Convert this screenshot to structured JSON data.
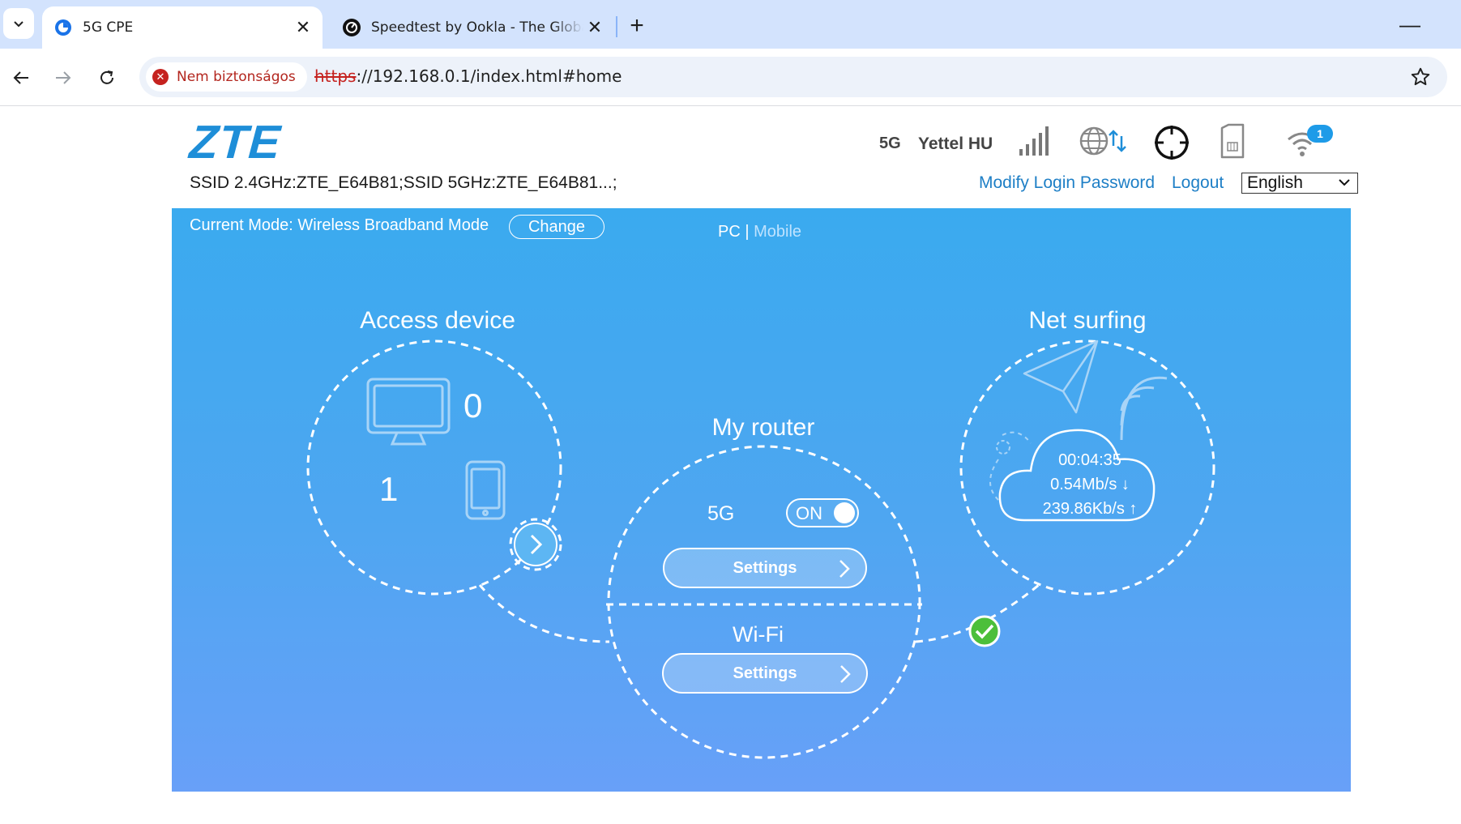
{
  "browser": {
    "tabs": [
      {
        "title": "5G CPE",
        "active": true
      },
      {
        "title": "Speedtest by Ookla - The Global Broadband Speed Test",
        "active": false
      }
    ],
    "security_label": "Nem biztonságos",
    "url_scheme": "https",
    "url_rest": "://192.168.0.1/index.html#home"
  },
  "header": {
    "logo": "ZTE",
    "ssid": "SSID 2.4GHz:ZTE_E64B81;SSID 5GHz:ZTE_E64B81...;",
    "network_type": "5G",
    "operator": "Yettel HU",
    "wifi_clients_badge": "1",
    "modify_password": "Modify Login Password",
    "logout": "Logout",
    "language": "English",
    "icons": [
      "signal-icon",
      "internet-status-icon",
      "target-icon",
      "sim-card-icon",
      "wifi-icon"
    ]
  },
  "panel": {
    "mode": "Current Mode: Wireless Broadband Mode",
    "change": "Change",
    "view_pc": "PC",
    "view_sep": "|",
    "view_mobile": "Mobile",
    "access_device": {
      "title": "Access device",
      "pc_count": "0",
      "mobile_count": "1"
    },
    "my_router": {
      "title": "My router",
      "band_label": "5G",
      "toggle_state": "ON",
      "settings_5g": "Settings",
      "wifi_label": "Wi-Fi",
      "settings_wifi": "Settings"
    },
    "net_surfing": {
      "title": "Net surfing",
      "duration": "00:04:35",
      "download": "0.54Mb/s ↓",
      "upload": "239.86Kb/s ↑"
    },
    "colors": {
      "panel_top": "#3aaaef",
      "panel_bottom": "#68a0f8",
      "link": "#1e7fc6",
      "logo": "#1e8ed8",
      "connected": "#4cbf3a"
    }
  }
}
